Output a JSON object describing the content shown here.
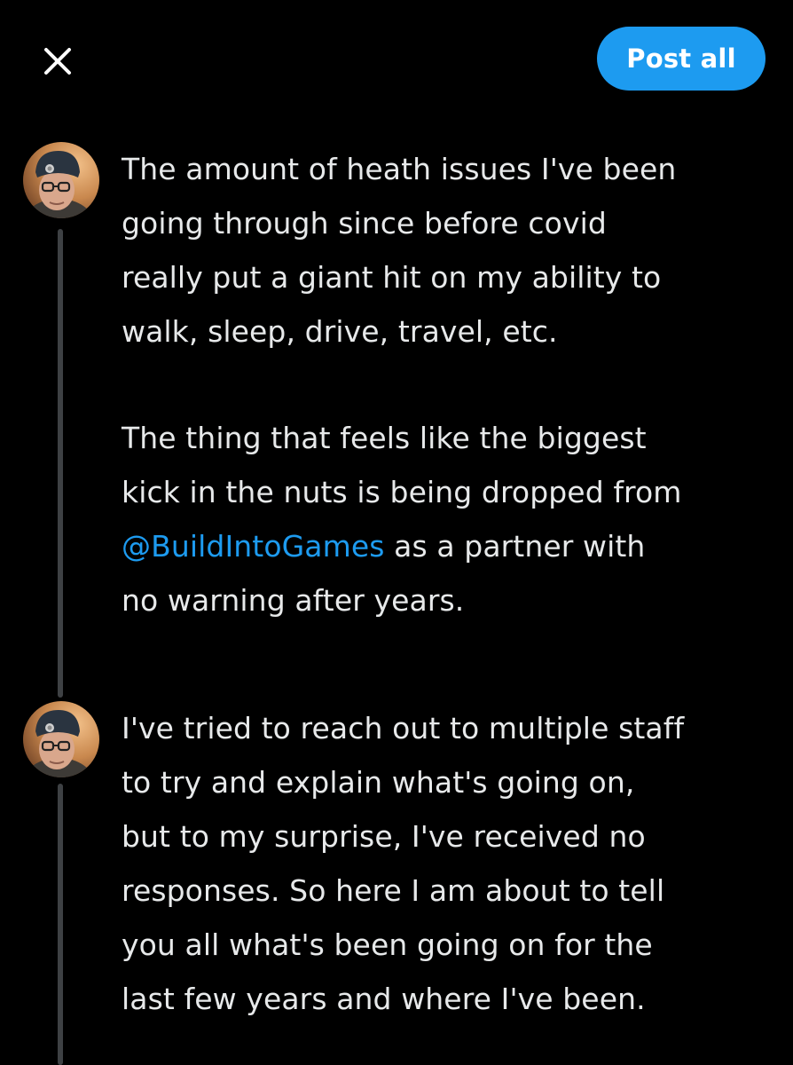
{
  "header": {
    "close_icon": "close-icon",
    "post_all_label": "Post all"
  },
  "colors": {
    "accent": "#1d9bf0",
    "background": "#000000",
    "text": "#e7e9ea",
    "thread_line": "#3e4144"
  },
  "posts": [
    {
      "avatar_icon": "user-avatar",
      "lines": [
        "The amount of heath issues I've been",
        "going through since before covid",
        "really put a giant hit on my ability to",
        "walk, sleep, drive, travel, etc."
      ],
      "lines2": [
        "The thing that feels like the biggest",
        "kick in the nuts is being dropped from"
      ],
      "mention": "@BuildIntoGames",
      "mention_tail": " as a partner with",
      "last_line": "no warning after years."
    },
    {
      "avatar_icon": "user-avatar",
      "lines": [
        "I've tried to reach out to multiple staff",
        "to try and explain what's going on,",
        "but to my surprise, I've received no",
        "responses. So here I am about to tell",
        "you all what's been going on for the",
        "last few years and where I've been."
      ]
    }
  ]
}
